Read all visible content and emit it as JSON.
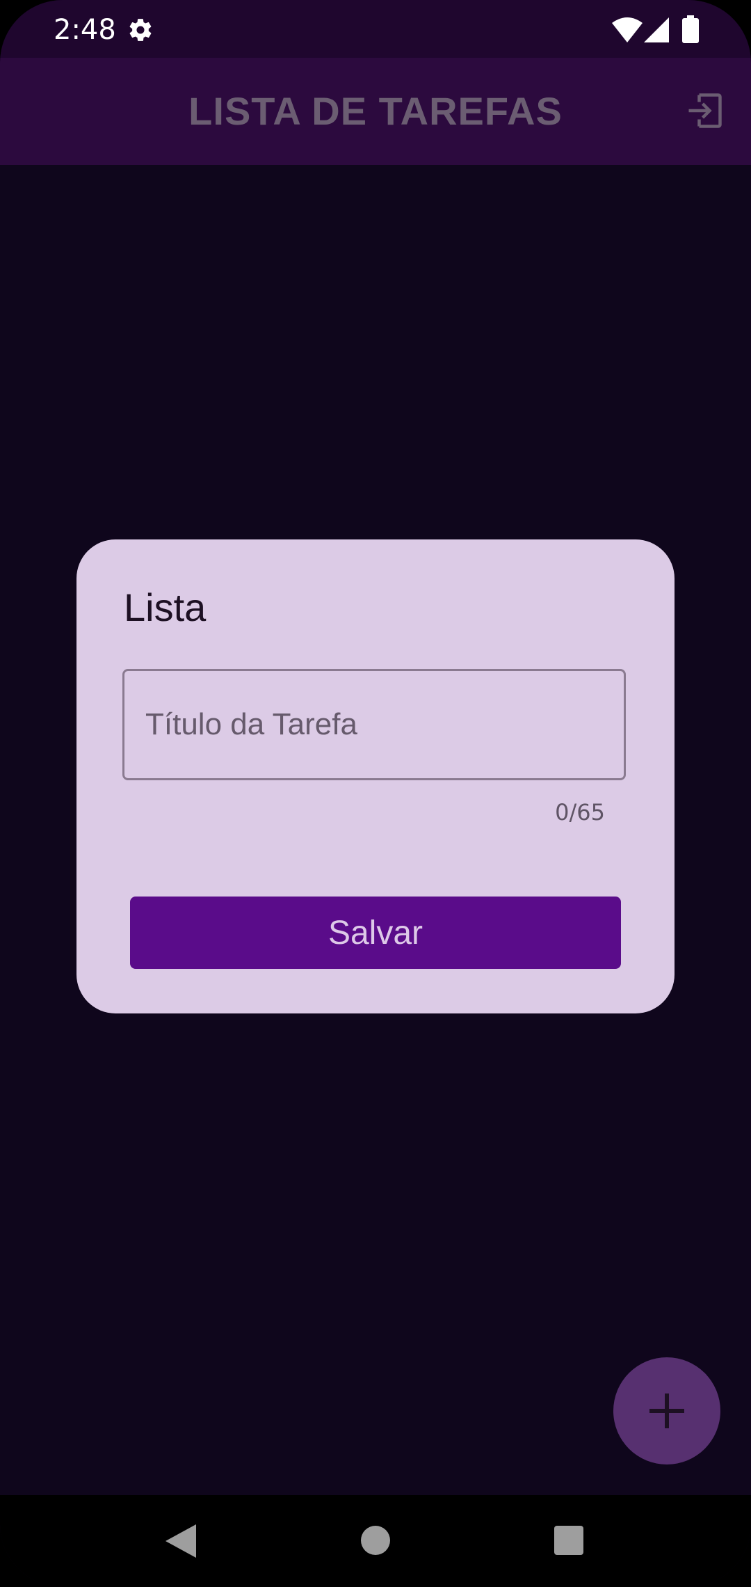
{
  "status_bar": {
    "time": "2:48",
    "icons": [
      "gear-icon",
      "wifi-icon",
      "signal-icon",
      "battery-icon"
    ]
  },
  "app_bar": {
    "title": "LISTA DE TAREFAS",
    "action_icon": "logout-icon"
  },
  "dialog": {
    "title": "Lista",
    "task_title_input": {
      "value": "",
      "placeholder": "Título da Tarefa"
    },
    "char_counter": "0/65",
    "save_label": "Salvar"
  },
  "fab": {
    "icon": "plus-icon"
  },
  "nav_bar": {
    "icons": [
      "back-icon",
      "home-icon",
      "recents-icon"
    ]
  },
  "colors": {
    "background": "#0f061c",
    "status_bar": "#1f062e",
    "app_bar": "#2c0a3e",
    "dialog": "#dccbe6",
    "save_button": "#5a0c8a",
    "fab": "#573070"
  }
}
